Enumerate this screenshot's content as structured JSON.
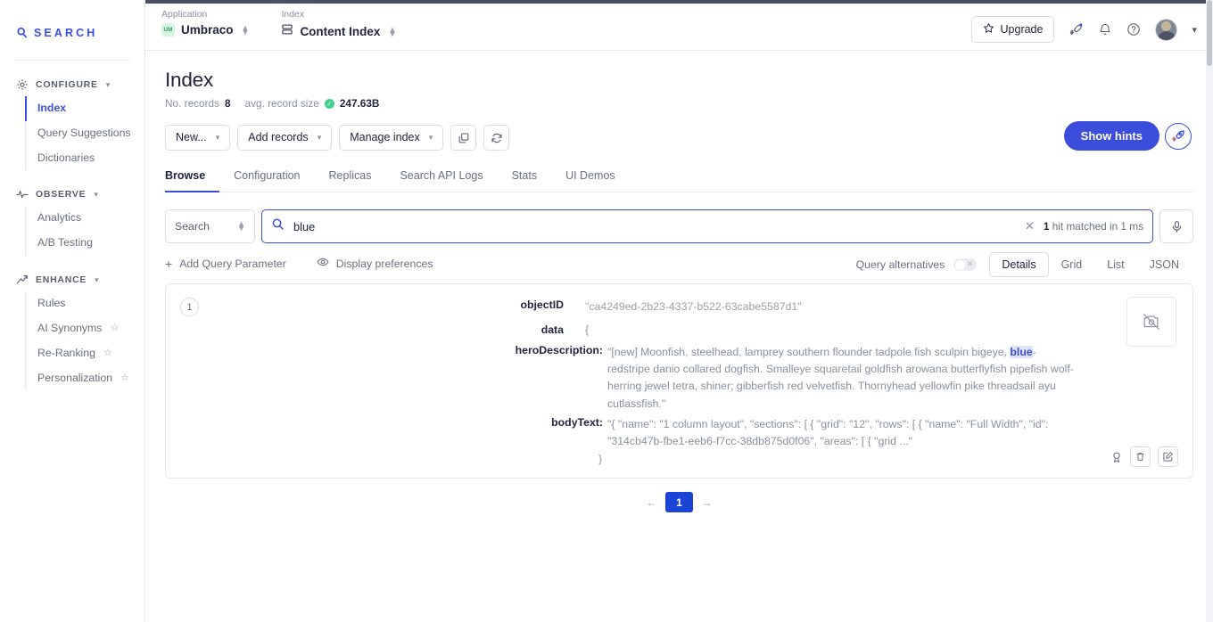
{
  "sidebar": {
    "brand": "SEARCH",
    "brand_icon": "search-logo-icon",
    "groups": [
      {
        "label": "CONFIGURE",
        "icon": "gear-icon",
        "items": [
          {
            "label": "Index",
            "active": true,
            "star": false
          },
          {
            "label": "Query Suggestions",
            "active": false,
            "star": false
          },
          {
            "label": "Dictionaries",
            "active": false,
            "star": false
          }
        ]
      },
      {
        "label": "OBSERVE",
        "icon": "pulse-icon",
        "items": [
          {
            "label": "Analytics",
            "active": false,
            "star": false
          },
          {
            "label": "A/B Testing",
            "active": false,
            "star": false
          }
        ]
      },
      {
        "label": "ENHANCE",
        "icon": "trend-up-icon",
        "items": [
          {
            "label": "Rules",
            "active": false,
            "star": false
          },
          {
            "label": "AI Synonyms",
            "active": false,
            "star": true
          },
          {
            "label": "Re-Ranking",
            "active": false,
            "star": true
          },
          {
            "label": "Personalization",
            "active": false,
            "star": true
          }
        ]
      }
    ]
  },
  "topbar": {
    "application_label": "Application",
    "application_value": "Umbraco",
    "application_badge": "UM",
    "index_label": "Index",
    "index_value": "Content Index",
    "upgrade_label": "Upgrade",
    "icons": [
      "star-icon",
      "rocket-icon",
      "bell-icon",
      "help-circle-icon",
      "avatar",
      "chevron-down-icon"
    ]
  },
  "page": {
    "title": "Index",
    "records_label": "No. records",
    "records_value": "8",
    "avg_size_label": "avg. record size",
    "avg_size_value": "247.63B"
  },
  "toolbar": {
    "new_label": "New...",
    "add_records_label": "Add records",
    "manage_index_label": "Manage index",
    "copy_icon": "copy-icon",
    "refresh_icon": "refresh-icon",
    "show_hints_label": "Show hints",
    "hints_icon": "rocket-badge-icon"
  },
  "tabs": [
    {
      "label": "Browse",
      "active": true
    },
    {
      "label": "Configuration",
      "active": false
    },
    {
      "label": "Replicas",
      "active": false
    },
    {
      "label": "Search API Logs",
      "active": false
    },
    {
      "label": "Stats",
      "active": false
    },
    {
      "label": "UI Demos",
      "active": false
    }
  ],
  "search": {
    "scope_label": "Search",
    "query": "blue",
    "placeholder": "Search",
    "clear_icon": "close-icon",
    "hits_count": "1",
    "hits_text": "hit matched in 1 ms",
    "mic_icon": "microphone-icon"
  },
  "options": {
    "add_query_parameter": "Add Query Parameter",
    "display_preferences": "Display preferences",
    "query_alternatives": "Query alternatives",
    "views": [
      {
        "label": "Details",
        "active": true
      },
      {
        "label": "Grid",
        "active": false
      },
      {
        "label": "List",
        "active": false
      },
      {
        "label": "JSON",
        "active": false
      }
    ]
  },
  "result": {
    "rank": "1",
    "objectID_key": "objectID",
    "objectID_value": "\"ca4249ed-2b23-4337-b522-63cabe5587d1\"",
    "data_key": "data",
    "open_brace": "{",
    "close_brace": "}",
    "hero_key": "heroDescription:",
    "hero_pre": "\"[new] Moonfish, steelhead, lamprey southern flounder tadpole fish sculpin bigeye, ",
    "hero_highlight": "blue",
    "hero_post": "-redstripe danio collared dogfish. Smalleye squaretail goldfish arowana butterflyfish pipefish wolf-herring jewel tetra, shiner; gibberfish red velvetfish. Thornyhead yellowfin pike threadsail ayu cutlassfish.\"",
    "body_key": "bodyText:",
    "body_value": "\"{ \"name\": \"1 column layout\", \"sections\": [ { \"grid\": \"12\", \"rows\": [ { \"name\": \"Full Width\", \"id\": \"314cb47b-fbe1-eeb6-f7cc-38db875d0f06\", \"areas\": [ { \"grid ...\"",
    "thumb_icon": "image-off-icon",
    "actions": [
      "badge-icon",
      "trash-icon",
      "edit-icon"
    ]
  },
  "pagination": {
    "prev_icon": "arrow-left-icon",
    "current": "1",
    "next_icon": "arrow-right-icon"
  },
  "colors": {
    "accent": "#3b4ddb",
    "accent_dark": "#1a44d6",
    "success": "#3ecf8e",
    "text": "#21243d",
    "muted": "#8b8fa0",
    "border": "#e7e7ed",
    "highlight_bg": "#dfe3fb"
  }
}
